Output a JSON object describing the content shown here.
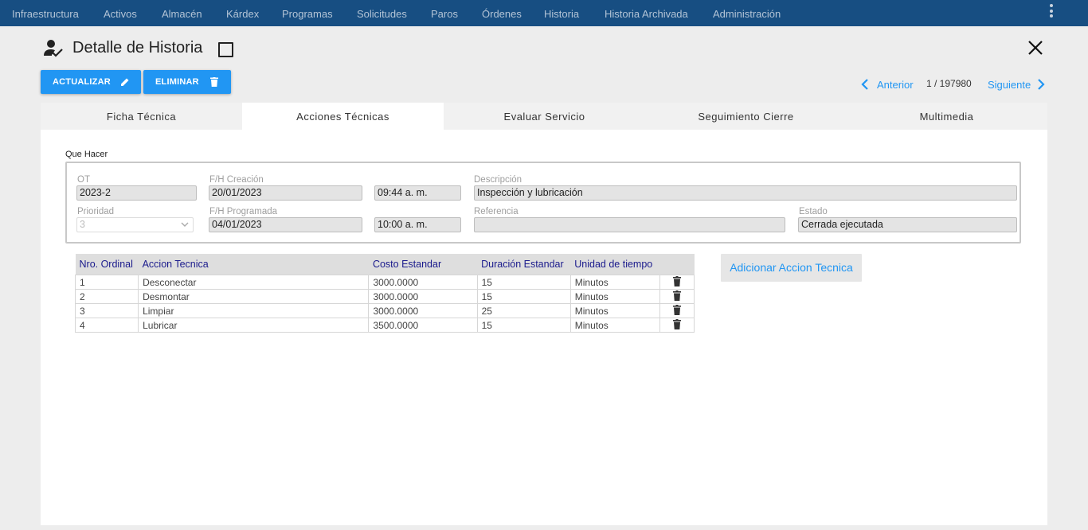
{
  "nav": {
    "items": [
      "Infraestructura",
      "Activos",
      "Almacén",
      "Kárdex",
      "Programas",
      "Solicitudes",
      "Paros",
      "Órdenes",
      "Historia",
      "Historia Archivada",
      "Administración"
    ]
  },
  "header": {
    "title": "Detalle de Historia",
    "actualizar_label": "ACTUALIZAR",
    "eliminar_label": "ELIMINAR"
  },
  "pager": {
    "prev_label": "Anterior",
    "count": "1 / 197980",
    "next_label": "Siguiente"
  },
  "tabs": [
    "Ficha Técnica",
    "Acciones Técnicas",
    "Evaluar Servicio",
    "Seguimiento Cierre",
    "Multimedia"
  ],
  "active_tab": "Acciones Técnicas",
  "form": {
    "legend": "Que Hacer",
    "ot": {
      "label": "OT",
      "value": "2023-2"
    },
    "fh_creacion": {
      "label": "F/H Creación",
      "date": "20/01/2023",
      "time": "09:44 a. m."
    },
    "descripcion": {
      "label": "Descripción",
      "value": "Inspección y lubricación"
    },
    "prioridad": {
      "label": "Prioridad",
      "value": "3"
    },
    "fh_programada": {
      "label": "F/H Programada",
      "date": "04/01/2023",
      "time": "10:00 a. m."
    },
    "referencia": {
      "label": "Referencia",
      "value": ""
    },
    "estado": {
      "label": "Estado",
      "value": "Cerrada ejecutada"
    }
  },
  "table": {
    "headers": [
      "Nro. Ordinal",
      "Accion Tecnica",
      "Costo Estandar",
      "Duración Estandar",
      "Unidad de tiempo"
    ],
    "rows": [
      [
        "1",
        "Desconectar",
        "3000.0000",
        "15",
        "Minutos"
      ],
      [
        "2",
        "Desmontar",
        "3000.0000",
        "15",
        "Minutos"
      ],
      [
        "3",
        "Limpiar",
        "3000.0000",
        "25",
        "Minutos"
      ],
      [
        "4",
        "Lubricar",
        "3500.0000",
        "15",
        "Minutos"
      ]
    ]
  },
  "add_button_label": "Adicionar Accion Tecnica",
  "icons": {
    "title": "person-check-icon",
    "close": "close-icon",
    "edit": "pencil-icon",
    "delete": "trash-icon",
    "menu": "kebab-menu-icon",
    "prev": "chevron-left-icon",
    "next": "chevron-right-icon"
  },
  "colors": {
    "nav_bg": "#174e82",
    "accent": "#2196f3",
    "header_text": "#1a1a8c"
  }
}
